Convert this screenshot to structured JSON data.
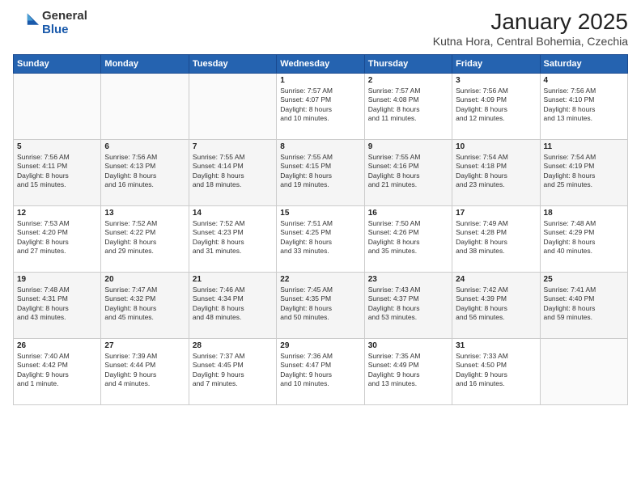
{
  "logo": {
    "general": "General",
    "blue": "Blue"
  },
  "header": {
    "month": "January 2025",
    "location": "Kutna Hora, Central Bohemia, Czechia"
  },
  "weekdays": [
    "Sunday",
    "Monday",
    "Tuesday",
    "Wednesday",
    "Thursday",
    "Friday",
    "Saturday"
  ],
  "weeks": [
    [
      {
        "day": "",
        "info": ""
      },
      {
        "day": "",
        "info": ""
      },
      {
        "day": "",
        "info": ""
      },
      {
        "day": "1",
        "info": "Sunrise: 7:57 AM\nSunset: 4:07 PM\nDaylight: 8 hours\nand 10 minutes."
      },
      {
        "day": "2",
        "info": "Sunrise: 7:57 AM\nSunset: 4:08 PM\nDaylight: 8 hours\nand 11 minutes."
      },
      {
        "day": "3",
        "info": "Sunrise: 7:56 AM\nSunset: 4:09 PM\nDaylight: 8 hours\nand 12 minutes."
      },
      {
        "day": "4",
        "info": "Sunrise: 7:56 AM\nSunset: 4:10 PM\nDaylight: 8 hours\nand 13 minutes."
      }
    ],
    [
      {
        "day": "5",
        "info": "Sunrise: 7:56 AM\nSunset: 4:11 PM\nDaylight: 8 hours\nand 15 minutes."
      },
      {
        "day": "6",
        "info": "Sunrise: 7:56 AM\nSunset: 4:13 PM\nDaylight: 8 hours\nand 16 minutes."
      },
      {
        "day": "7",
        "info": "Sunrise: 7:55 AM\nSunset: 4:14 PM\nDaylight: 8 hours\nand 18 minutes."
      },
      {
        "day": "8",
        "info": "Sunrise: 7:55 AM\nSunset: 4:15 PM\nDaylight: 8 hours\nand 19 minutes."
      },
      {
        "day": "9",
        "info": "Sunrise: 7:55 AM\nSunset: 4:16 PM\nDaylight: 8 hours\nand 21 minutes."
      },
      {
        "day": "10",
        "info": "Sunrise: 7:54 AM\nSunset: 4:18 PM\nDaylight: 8 hours\nand 23 minutes."
      },
      {
        "day": "11",
        "info": "Sunrise: 7:54 AM\nSunset: 4:19 PM\nDaylight: 8 hours\nand 25 minutes."
      }
    ],
    [
      {
        "day": "12",
        "info": "Sunrise: 7:53 AM\nSunset: 4:20 PM\nDaylight: 8 hours\nand 27 minutes."
      },
      {
        "day": "13",
        "info": "Sunrise: 7:52 AM\nSunset: 4:22 PM\nDaylight: 8 hours\nand 29 minutes."
      },
      {
        "day": "14",
        "info": "Sunrise: 7:52 AM\nSunset: 4:23 PM\nDaylight: 8 hours\nand 31 minutes."
      },
      {
        "day": "15",
        "info": "Sunrise: 7:51 AM\nSunset: 4:25 PM\nDaylight: 8 hours\nand 33 minutes."
      },
      {
        "day": "16",
        "info": "Sunrise: 7:50 AM\nSunset: 4:26 PM\nDaylight: 8 hours\nand 35 minutes."
      },
      {
        "day": "17",
        "info": "Sunrise: 7:49 AM\nSunset: 4:28 PM\nDaylight: 8 hours\nand 38 minutes."
      },
      {
        "day": "18",
        "info": "Sunrise: 7:48 AM\nSunset: 4:29 PM\nDaylight: 8 hours\nand 40 minutes."
      }
    ],
    [
      {
        "day": "19",
        "info": "Sunrise: 7:48 AM\nSunset: 4:31 PM\nDaylight: 8 hours\nand 43 minutes."
      },
      {
        "day": "20",
        "info": "Sunrise: 7:47 AM\nSunset: 4:32 PM\nDaylight: 8 hours\nand 45 minutes."
      },
      {
        "day": "21",
        "info": "Sunrise: 7:46 AM\nSunset: 4:34 PM\nDaylight: 8 hours\nand 48 minutes."
      },
      {
        "day": "22",
        "info": "Sunrise: 7:45 AM\nSunset: 4:35 PM\nDaylight: 8 hours\nand 50 minutes."
      },
      {
        "day": "23",
        "info": "Sunrise: 7:43 AM\nSunset: 4:37 PM\nDaylight: 8 hours\nand 53 minutes."
      },
      {
        "day": "24",
        "info": "Sunrise: 7:42 AM\nSunset: 4:39 PM\nDaylight: 8 hours\nand 56 minutes."
      },
      {
        "day": "25",
        "info": "Sunrise: 7:41 AM\nSunset: 4:40 PM\nDaylight: 8 hours\nand 59 minutes."
      }
    ],
    [
      {
        "day": "26",
        "info": "Sunrise: 7:40 AM\nSunset: 4:42 PM\nDaylight: 9 hours\nand 1 minute."
      },
      {
        "day": "27",
        "info": "Sunrise: 7:39 AM\nSunset: 4:44 PM\nDaylight: 9 hours\nand 4 minutes."
      },
      {
        "day": "28",
        "info": "Sunrise: 7:37 AM\nSunset: 4:45 PM\nDaylight: 9 hours\nand 7 minutes."
      },
      {
        "day": "29",
        "info": "Sunrise: 7:36 AM\nSunset: 4:47 PM\nDaylight: 9 hours\nand 10 minutes."
      },
      {
        "day": "30",
        "info": "Sunrise: 7:35 AM\nSunset: 4:49 PM\nDaylight: 9 hours\nand 13 minutes."
      },
      {
        "day": "31",
        "info": "Sunrise: 7:33 AM\nSunset: 4:50 PM\nDaylight: 9 hours\nand 16 minutes."
      },
      {
        "day": "",
        "info": ""
      }
    ]
  ]
}
